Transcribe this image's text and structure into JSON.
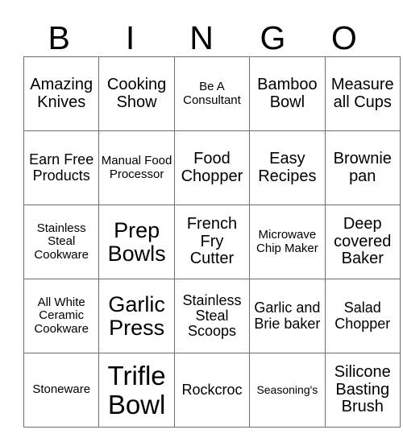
{
  "card": {
    "header_letters": [
      "B",
      "I",
      "N",
      "G",
      "O"
    ],
    "border_color": "#6e6e6e",
    "text_color": "#000000",
    "background_color": "#ffffff",
    "rows": [
      [
        {
          "text": "Amazing Knives",
          "size": "lg"
        },
        {
          "text": "Cooking Show",
          "size": "lg"
        },
        {
          "text": "Be A Consultant",
          "size": "sm"
        },
        {
          "text": "Bamboo Bowl",
          "size": "lg"
        },
        {
          "text": "Measure all Cups",
          "size": "lg"
        }
      ],
      [
        {
          "text": "Earn Free Products",
          "size": "md"
        },
        {
          "text": "Manual Food Processor",
          "size": "sm"
        },
        {
          "text": "Food Chopper",
          "size": "lg"
        },
        {
          "text": "Easy Recipes",
          "size": "lg"
        },
        {
          "text": "Brownie pan",
          "size": "lg"
        }
      ],
      [
        {
          "text": "Stainless Steal Cookware",
          "size": "sm"
        },
        {
          "text": "Prep Bowls",
          "size": "xl"
        },
        {
          "text": "French Fry Cutter",
          "size": "lg"
        },
        {
          "text": "Microwave Chip Maker",
          "size": "sm"
        },
        {
          "text": "Deep covered Baker",
          "size": "lg"
        }
      ],
      [
        {
          "text": "All White Ceramic Cookware",
          "size": "sm"
        },
        {
          "text": "Garlic Press",
          "size": "xl"
        },
        {
          "text": "Stainless Steal Scoops",
          "size": "md"
        },
        {
          "text": "Garlic and Brie baker",
          "size": "md"
        },
        {
          "text": "Salad Chopper",
          "size": "md"
        }
      ],
      [
        {
          "text": "Stoneware",
          "size": "sm"
        },
        {
          "text": "Trifle Bowl",
          "size": "xxl"
        },
        {
          "text": "Rockcroc",
          "size": "md"
        },
        {
          "text": "Seasoning's",
          "size": "xs"
        },
        {
          "text": "Silicone Basting Brush",
          "size": "lg"
        }
      ]
    ]
  }
}
